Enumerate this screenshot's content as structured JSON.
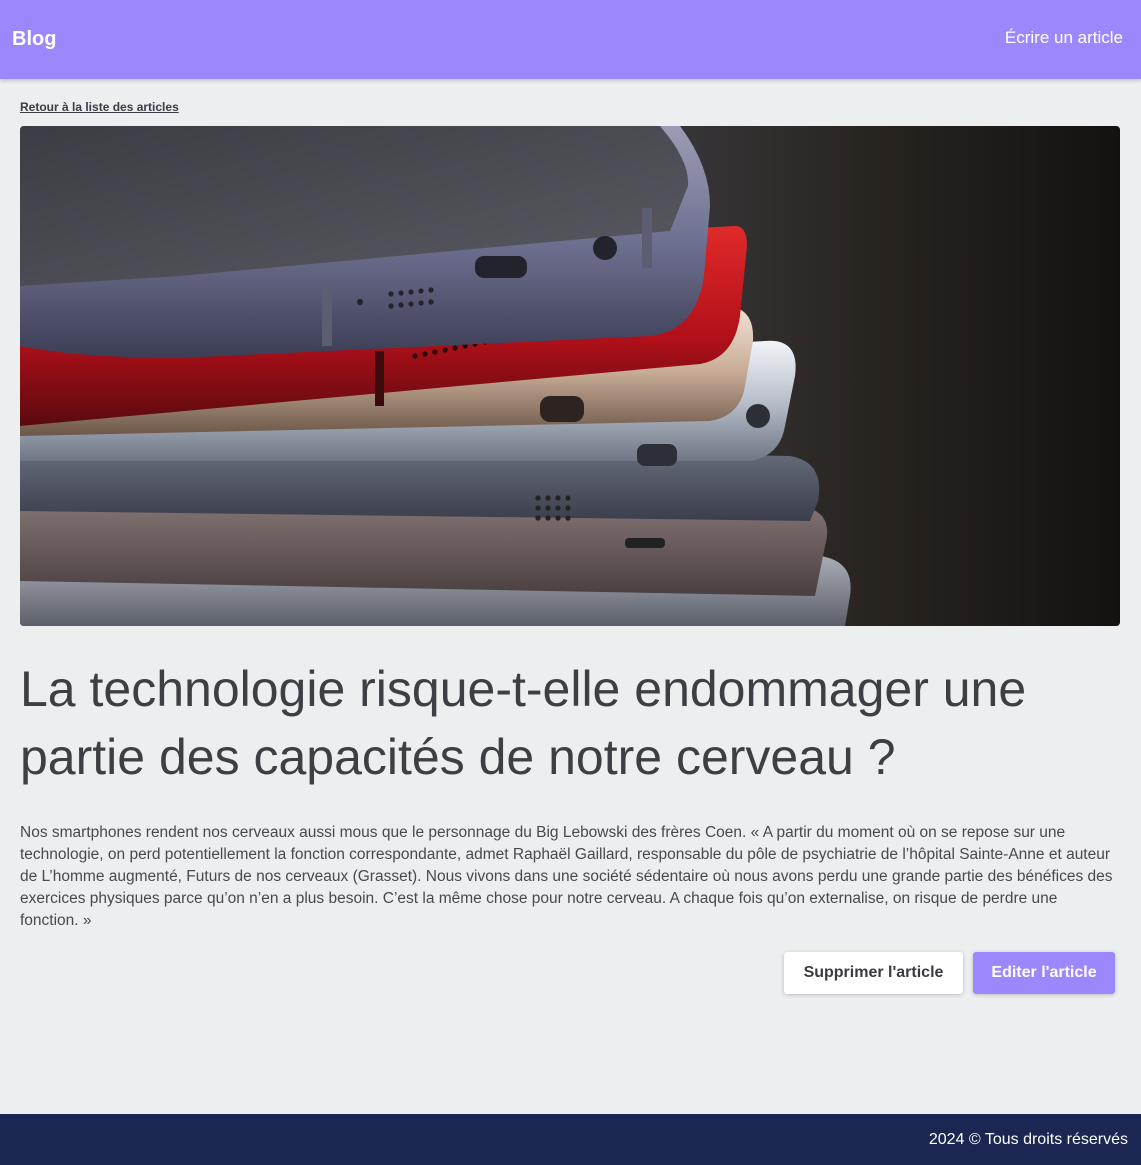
{
  "navbar": {
    "brand": "Blog",
    "write_link": "Écrire un article",
    "color": "#9d87fd"
  },
  "back_link": "Retour à la liste des articles",
  "hero_image": {
    "subject": "stack-of-smartphones"
  },
  "article": {
    "title": "La technologie risque-t-elle endommager une partie des capacités de notre cerveau ?",
    "body": "Nos smartphones rendent nos cerveaux aussi mous que le personnage du Big Lebowski des frères Coen. « A partir du moment où on se repose sur une technologie, on perd potentiellement la fonction correspondante, admet Raphaël Gaillard, responsable du pôle de psychiatrie de l’hôpital Sainte-Anne et auteur de L’homme augmenté, Futurs de nos cerveaux (Grasset). Nous vivons dans une société sédentaire où nous avons perdu une grande partie des bénéfices des exercices physiques parce qu’on n’en a plus besoin. C’est la même chose pour notre cerveau. A chaque fois qu’on externalise, on risque de perdre une fonction. »"
  },
  "actions": {
    "delete_label": "Supprimer l'article",
    "edit_label": "Editer l'article"
  },
  "footer": {
    "text": "2024 © Tous droits réservés",
    "color": "#1b2752"
  }
}
